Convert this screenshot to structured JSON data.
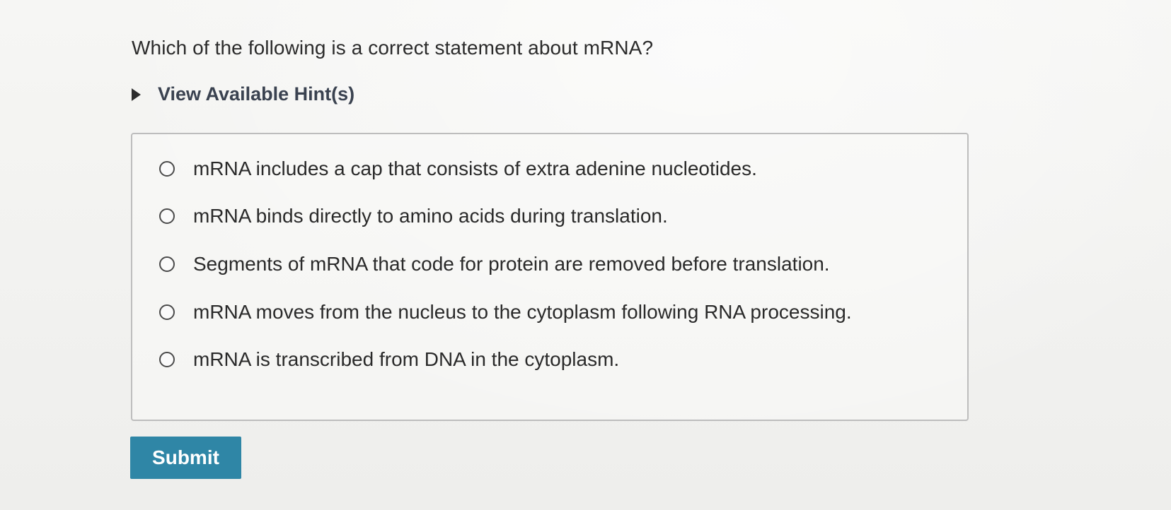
{
  "question": {
    "text": "Which of the following is a correct statement about mRNA?"
  },
  "hints": {
    "label": "View Available Hint(s)",
    "icon": "caret-right-icon"
  },
  "choices": [
    {
      "label": "mRNA includes a cap that consists of extra adenine nucleotides.",
      "selected": false
    },
    {
      "label": "mRNA binds directly to amino acids during translation.",
      "selected": false
    },
    {
      "label": "Segments of mRNA that code for protein are removed before translation.",
      "selected": false
    },
    {
      "label": "mRNA moves from the nucleus to the cytoplasm following RNA processing.",
      "selected": false
    },
    {
      "label": "mRNA is transcribed from DNA in the cytoplasm.",
      "selected": false
    }
  ],
  "submit": {
    "label": "Submit"
  },
  "colors": {
    "submit_background": "#2f86a6",
    "hint_text": "#3a4250",
    "border": "#bdbdbd"
  }
}
